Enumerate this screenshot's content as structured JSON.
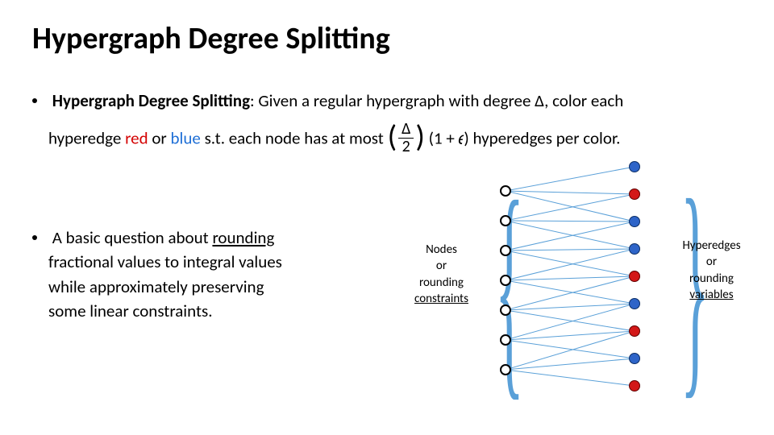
{
  "title": "Hypergraph Degree Splitting",
  "definition": {
    "label_bold": "Hypergraph Degree Splitting",
    "given": ": Given a regular hypergraph with degree Δ, color each",
    "line2_a": "hyperedge ",
    "red": "red",
    "or": " or ",
    "blue": "blue",
    "line2_b": " s.t. each node has at most ",
    "frac_num": "Δ",
    "frac_den": "2",
    "one_plus_eps": " (1 + 𝜖) ",
    "tail": "hyperedges per color."
  },
  "question": {
    "line1": "A basic question about ",
    "rounding": "rounding",
    "line2": "fractional values to integral values",
    "line3": "while approximately preserving",
    "line4": "some linear constraints."
  },
  "labels": {
    "nodes_l1": "Nodes",
    "nodes_l2": "or",
    "nodes_l3": "rounding",
    "nodes_l4": "constraints",
    "edges_l1": "Hyperedges",
    "edges_l2": "or",
    "edges_l3": "rounding",
    "edges_l4": "variables"
  },
  "diagram": {
    "left_nodes": [
      0,
      1,
      2,
      3,
      4,
      5,
      6
    ],
    "right_colors": [
      "blue",
      "red",
      "blue",
      "blue",
      "red",
      "blue",
      "red",
      "blue",
      "red"
    ],
    "edges": [
      [
        0,
        0
      ],
      [
        0,
        1
      ],
      [
        0,
        2
      ],
      [
        1,
        1
      ],
      [
        1,
        2
      ],
      [
        1,
        3
      ],
      [
        2,
        2
      ],
      [
        2,
        3
      ],
      [
        2,
        4
      ],
      [
        3,
        3
      ],
      [
        3,
        4
      ],
      [
        3,
        5
      ],
      [
        4,
        4
      ],
      [
        4,
        5
      ],
      [
        4,
        6
      ],
      [
        5,
        5
      ],
      [
        5,
        6
      ],
      [
        5,
        7
      ],
      [
        6,
        6
      ],
      [
        6,
        7
      ],
      [
        6,
        8
      ]
    ]
  }
}
